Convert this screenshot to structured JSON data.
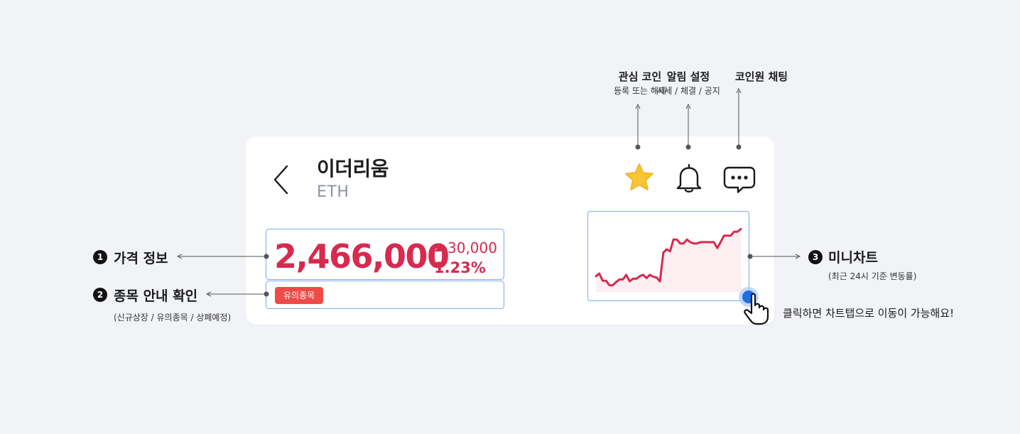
{
  "header": {
    "coin_name": "이더리움",
    "coin_symbol": "ETH"
  },
  "price": {
    "current": "2,466,000",
    "change_amount": "30,000",
    "change_rate": "1.23%",
    "direction": "up",
    "color": "#d8294f"
  },
  "caution": {
    "badge_label": "유의종목",
    "badge_color": "#ef4a46"
  },
  "icons": {
    "back": "chevron-left-icon",
    "favorite": "star-icon",
    "alarm": "bell-icon",
    "chat": "chat-bubble-icon",
    "tap": "pointing-hand-icon"
  },
  "annotations": {
    "favorite": {
      "title": "관심 코인",
      "desc": "등록 또는 해제"
    },
    "alarm": {
      "title": "알림 설정",
      "desc": "시세 / 체결 / 공지"
    },
    "chat": {
      "title": "코인원 채팅"
    },
    "price_info": {
      "number": "1",
      "title": "가격 정보"
    },
    "caution_info": {
      "number": "2",
      "title": "종목 안내 확인",
      "desc": "(신규상장 / 유의종목 / 상폐예정)"
    },
    "mini_chart": {
      "number": "3",
      "title": "미니차트",
      "desc": "(최근 24시 기준 변동률)"
    },
    "chart_hint": "클릭하면 차트탭으로 이동이 가능해요!"
  },
  "colors": {
    "accent_border": "#7fa8ea",
    "star": "#f7c537",
    "chart_line": "#d8294f",
    "chart_fill": "#fdeff1",
    "tap_dot": "#1f6fe0"
  },
  "chart_data": {
    "type": "line",
    "title": "",
    "xlabel": "",
    "ylabel": "",
    "x": [
      0,
      1,
      2,
      3,
      4,
      5,
      6,
      7,
      8,
      9,
      10,
      11,
      12,
      13,
      14,
      15,
      16,
      17,
      18,
      19,
      20,
      21,
      22,
      23,
      24,
      25,
      26,
      27,
      28,
      29,
      30,
      31,
      32,
      33,
      34,
      35,
      36,
      37,
      38,
      39,
      40,
      41,
      42,
      43
    ],
    "values": [
      0.22,
      0.26,
      0.15,
      0.15,
      0.08,
      0.08,
      0.13,
      0.17,
      0.17,
      0.24,
      0.14,
      0.18,
      0.18,
      0.22,
      0.24,
      0.19,
      0.24,
      0.21,
      0.2,
      0.14,
      0.58,
      0.63,
      0.6,
      0.78,
      0.78,
      0.72,
      0.72,
      0.78,
      0.74,
      0.72,
      0.72,
      0.74,
      0.74,
      0.74,
      0.74,
      0.74,
      0.65,
      0.74,
      0.84,
      0.84,
      0.84,
      0.9,
      0.9,
      0.94
    ],
    "ylim": [
      0,
      1
    ],
    "grid": false,
    "legend": "none"
  }
}
